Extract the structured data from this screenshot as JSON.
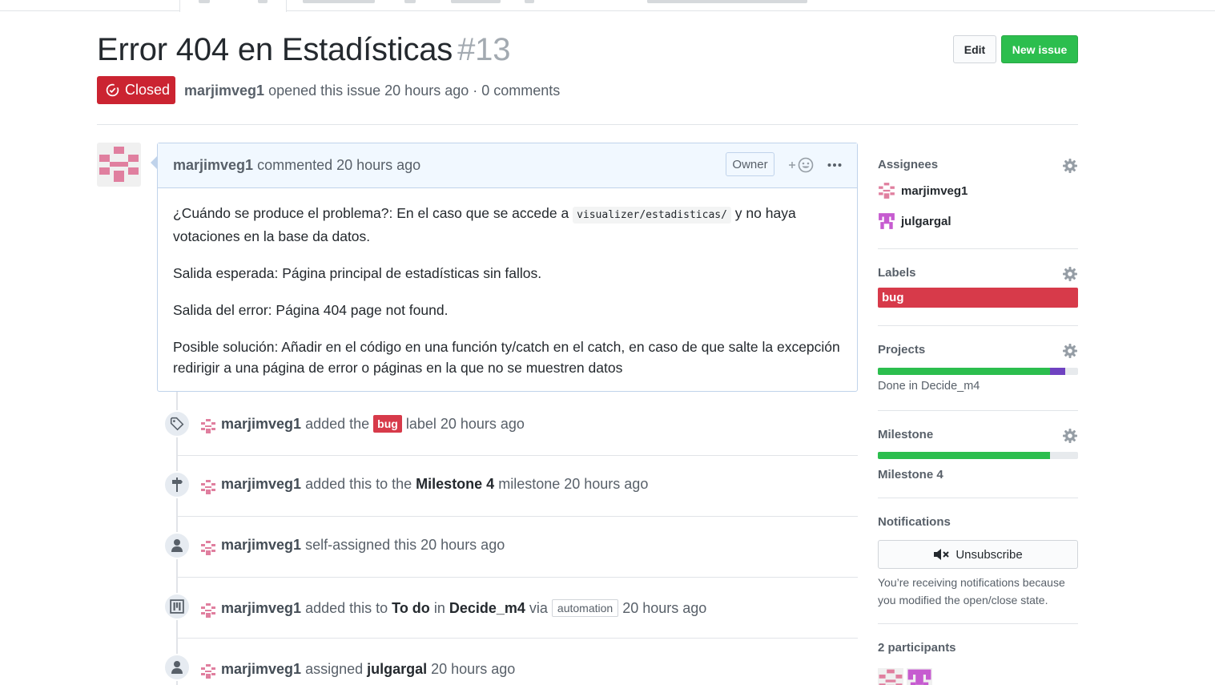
{
  "issue": {
    "title": "Error 404 en Estadísticas",
    "number": "#13",
    "state": "Closed",
    "author": "marjimveg1",
    "meta_rest": " opened this issue 20 hours ago · 0 comments"
  },
  "header_actions": {
    "edit_label": "Edit",
    "new_issue_label": "New issue"
  },
  "comment": {
    "author": "marjimveg1",
    "action": " commented 20 hours ago",
    "owner_badge": "Owner",
    "body": {
      "p1_pre": "¿Cuándo se produce el problema?: En el caso que se accede a ",
      "p1_code": "visualizer/estadisticas/",
      "p1_post": " y no haya votaciones en la base da datos.",
      "p2": "Salida esperada: Página principal de estadísticas sin fallos.",
      "p3": "Salida del error: Página 404 page not found.",
      "p4": "Posible solución: Añadir en el código en una función ty/catch en el catch, en caso de que salte la excepción redirigir a una página de error o páginas en la que no se muestren datos"
    }
  },
  "timeline": {
    "e1": {
      "icon": "tag-icon",
      "actor": "marjimveg1",
      "t1": " added the ",
      "label": "bug",
      "t2": " label 20 hours ago"
    },
    "e2": {
      "icon": "milestone-icon",
      "actor": "marjimveg1",
      "t1": " added this to the ",
      "target": "Milestone 4",
      "t2": " milestone 20 hours ago"
    },
    "e3": {
      "icon": "person-icon",
      "actor": "marjimveg1",
      "t1": " self-assigned this 20 hours ago"
    },
    "e4": {
      "icon": "project-icon",
      "actor": "marjimveg1",
      "t1": " added this to ",
      "column": "To do",
      "t2": " in ",
      "project": "Decide_m4",
      "t3": " via ",
      "via": "automation",
      "t4": " 20 hours ago"
    },
    "e5": {
      "icon": "person-icon",
      "actor": "marjimveg1",
      "t1": " assigned ",
      "target": "julgargal",
      "t2": " 20 hours ago"
    }
  },
  "sidebar": {
    "assignees": {
      "heading": "Assignees",
      "users": [
        "marjimveg1",
        "julgargal"
      ]
    },
    "labels": {
      "heading": "Labels",
      "items": [
        "bug"
      ],
      "colors": [
        "#d73a4a"
      ]
    },
    "projects": {
      "heading": "Projects",
      "status": "Done in Decide_m4",
      "done_fraction": 0.86,
      "in_progress_fraction": 0.075
    },
    "milestone": {
      "heading": "Milestone",
      "name": "Milestone 4",
      "progress_fraction": 0.86
    },
    "notifications": {
      "heading": "Notifications",
      "button": "Unsubscribe",
      "reason": "You’re receiving notifications because you modified the open/close state."
    },
    "participants": {
      "heading": "2 participants"
    }
  },
  "colors": {
    "closed": "#cb2431",
    "new_issue": "#2cbe4e",
    "label_bug": "#d73a4a",
    "project_in_progress": "#6f42c1",
    "identicon_marjimveg1": "#e07f9f",
    "identicon_julgargal": "#c65bd0"
  }
}
